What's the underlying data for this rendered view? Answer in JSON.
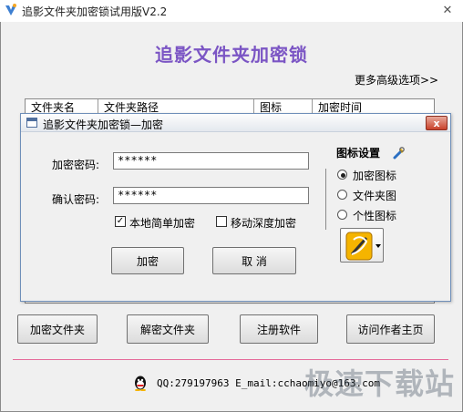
{
  "window": {
    "title": "追影文件夹加密锁试用版V2.2",
    "close_glyph": "✕"
  },
  "header": {
    "app_title": "追影文件夹加密锁",
    "more_options": "更多高级选项>>"
  },
  "list": {
    "columns": [
      "文件夹名",
      "文件夹路径",
      "图标",
      "加密时间"
    ]
  },
  "dialog": {
    "title": "追影文件夹加密锁—加密",
    "close_glyph": "x",
    "password_label": "加密密码:",
    "password_value": "******",
    "confirm_label": "确认密码:",
    "confirm_value": "******",
    "local_simple_label": "本地简单加密",
    "local_simple_checked": "✓",
    "mobile_deep_label": "移动深度加密",
    "encrypt_button": "加密",
    "cancel_button": "取 消",
    "icon_settings_title": "图标设置",
    "icon_options": [
      "加密图标",
      "文件夹图",
      "个性图标"
    ]
  },
  "bottom_buttons": [
    "加密文件夹",
    "解密文件夹",
    "注册软件",
    "访问作者主页"
  ],
  "footer": {
    "contact": "QQ:279197963  E_mail:cchaomiyo@163.com"
  },
  "watermark": "极速下载站",
  "colors": {
    "title_purple": "#7b55c4",
    "divider_pink": "#e56a9a",
    "dialog_close_red": "#c9412a"
  }
}
